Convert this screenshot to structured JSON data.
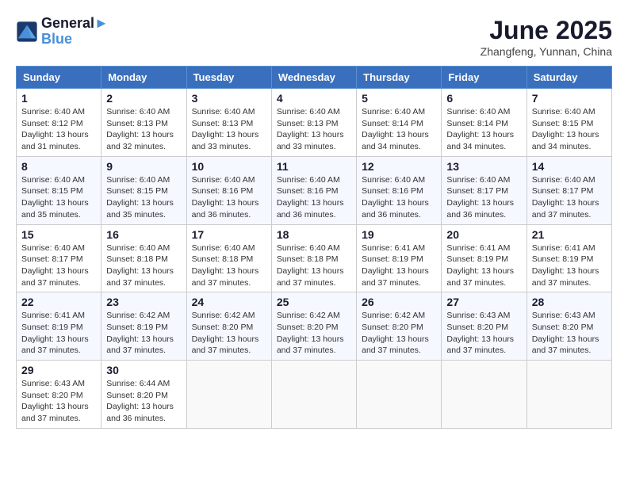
{
  "header": {
    "logo_line1": "General",
    "logo_line2": "Blue",
    "month": "June 2025",
    "location": "Zhangfeng, Yunnan, China"
  },
  "days_of_week": [
    "Sunday",
    "Monday",
    "Tuesday",
    "Wednesday",
    "Thursday",
    "Friday",
    "Saturday"
  ],
  "weeks": [
    [
      {
        "day": "1",
        "info": "Sunrise: 6:40 AM\nSunset: 8:12 PM\nDaylight: 13 hours and 31 minutes."
      },
      {
        "day": "2",
        "info": "Sunrise: 6:40 AM\nSunset: 8:13 PM\nDaylight: 13 hours and 32 minutes."
      },
      {
        "day": "3",
        "info": "Sunrise: 6:40 AM\nSunset: 8:13 PM\nDaylight: 13 hours and 33 minutes."
      },
      {
        "day": "4",
        "info": "Sunrise: 6:40 AM\nSunset: 8:13 PM\nDaylight: 13 hours and 33 minutes."
      },
      {
        "day": "5",
        "info": "Sunrise: 6:40 AM\nSunset: 8:14 PM\nDaylight: 13 hours and 34 minutes."
      },
      {
        "day": "6",
        "info": "Sunrise: 6:40 AM\nSunset: 8:14 PM\nDaylight: 13 hours and 34 minutes."
      },
      {
        "day": "7",
        "info": "Sunrise: 6:40 AM\nSunset: 8:15 PM\nDaylight: 13 hours and 34 minutes."
      }
    ],
    [
      {
        "day": "8",
        "info": "Sunrise: 6:40 AM\nSunset: 8:15 PM\nDaylight: 13 hours and 35 minutes."
      },
      {
        "day": "9",
        "info": "Sunrise: 6:40 AM\nSunset: 8:15 PM\nDaylight: 13 hours and 35 minutes."
      },
      {
        "day": "10",
        "info": "Sunrise: 6:40 AM\nSunset: 8:16 PM\nDaylight: 13 hours and 36 minutes."
      },
      {
        "day": "11",
        "info": "Sunrise: 6:40 AM\nSunset: 8:16 PM\nDaylight: 13 hours and 36 minutes."
      },
      {
        "day": "12",
        "info": "Sunrise: 6:40 AM\nSunset: 8:16 PM\nDaylight: 13 hours and 36 minutes."
      },
      {
        "day": "13",
        "info": "Sunrise: 6:40 AM\nSunset: 8:17 PM\nDaylight: 13 hours and 36 minutes."
      },
      {
        "day": "14",
        "info": "Sunrise: 6:40 AM\nSunset: 8:17 PM\nDaylight: 13 hours and 37 minutes."
      }
    ],
    [
      {
        "day": "15",
        "info": "Sunrise: 6:40 AM\nSunset: 8:17 PM\nDaylight: 13 hours and 37 minutes."
      },
      {
        "day": "16",
        "info": "Sunrise: 6:40 AM\nSunset: 8:18 PM\nDaylight: 13 hours and 37 minutes."
      },
      {
        "day": "17",
        "info": "Sunrise: 6:40 AM\nSunset: 8:18 PM\nDaylight: 13 hours and 37 minutes."
      },
      {
        "day": "18",
        "info": "Sunrise: 6:40 AM\nSunset: 8:18 PM\nDaylight: 13 hours and 37 minutes."
      },
      {
        "day": "19",
        "info": "Sunrise: 6:41 AM\nSunset: 8:19 PM\nDaylight: 13 hours and 37 minutes."
      },
      {
        "day": "20",
        "info": "Sunrise: 6:41 AM\nSunset: 8:19 PM\nDaylight: 13 hours and 37 minutes."
      },
      {
        "day": "21",
        "info": "Sunrise: 6:41 AM\nSunset: 8:19 PM\nDaylight: 13 hours and 37 minutes."
      }
    ],
    [
      {
        "day": "22",
        "info": "Sunrise: 6:41 AM\nSunset: 8:19 PM\nDaylight: 13 hours and 37 minutes."
      },
      {
        "day": "23",
        "info": "Sunrise: 6:42 AM\nSunset: 8:19 PM\nDaylight: 13 hours and 37 minutes."
      },
      {
        "day": "24",
        "info": "Sunrise: 6:42 AM\nSunset: 8:20 PM\nDaylight: 13 hours and 37 minutes."
      },
      {
        "day": "25",
        "info": "Sunrise: 6:42 AM\nSunset: 8:20 PM\nDaylight: 13 hours and 37 minutes."
      },
      {
        "day": "26",
        "info": "Sunrise: 6:42 AM\nSunset: 8:20 PM\nDaylight: 13 hours and 37 minutes."
      },
      {
        "day": "27",
        "info": "Sunrise: 6:43 AM\nSunset: 8:20 PM\nDaylight: 13 hours and 37 minutes."
      },
      {
        "day": "28",
        "info": "Sunrise: 6:43 AM\nSunset: 8:20 PM\nDaylight: 13 hours and 37 minutes."
      }
    ],
    [
      {
        "day": "29",
        "info": "Sunrise: 6:43 AM\nSunset: 8:20 PM\nDaylight: 13 hours and 37 minutes."
      },
      {
        "day": "30",
        "info": "Sunrise: 6:44 AM\nSunset: 8:20 PM\nDaylight: 13 hours and 36 minutes."
      },
      {
        "day": "",
        "info": ""
      },
      {
        "day": "",
        "info": ""
      },
      {
        "day": "",
        "info": ""
      },
      {
        "day": "",
        "info": ""
      },
      {
        "day": "",
        "info": ""
      }
    ]
  ]
}
